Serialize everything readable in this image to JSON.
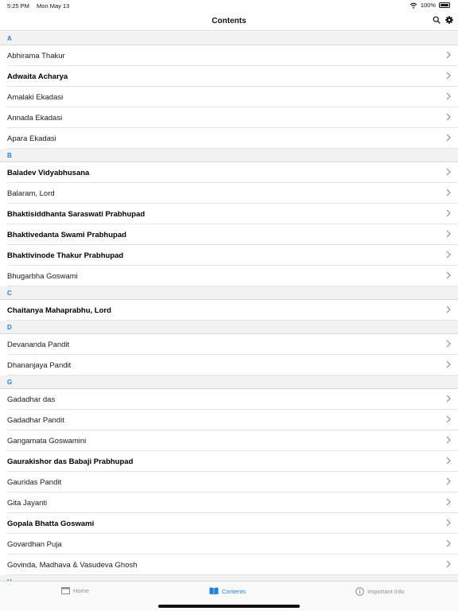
{
  "status_bar": {
    "time": "5:25 PM",
    "date": "Mon May 13",
    "battery": "100%"
  },
  "nav": {
    "title": "Contents",
    "actions": [
      "search-icon",
      "gear-icon"
    ]
  },
  "sections": [
    {
      "letter": "A",
      "items": [
        {
          "label": "Abhirama Thakur",
          "bold": false
        },
        {
          "label": "Adwaita Acharya",
          "bold": true
        },
        {
          "label": "Amalaki Ekadasi",
          "bold": false
        },
        {
          "label": "Annada Ekadasi",
          "bold": false
        },
        {
          "label": "Apara Ekadasi",
          "bold": false
        }
      ]
    },
    {
      "letter": "B",
      "items": [
        {
          "label": "Baladev Vidyabhusana",
          "bold": true
        },
        {
          "label": "Balaram, Lord",
          "bold": false
        },
        {
          "label": "Bhaktisiddhanta Saraswati Prabhupad",
          "bold": true
        },
        {
          "label": "Bhaktivedanta Swami Prabhupad",
          "bold": true
        },
        {
          "label": "Bhaktivinode Thakur Prabhupad",
          "bold": true
        },
        {
          "label": "Bhugarbha Goswami",
          "bold": false
        }
      ]
    },
    {
      "letter": "C",
      "items": [
        {
          "label": "Chaitanya Mahaprabhu, Lord",
          "bold": true
        }
      ]
    },
    {
      "letter": "D",
      "items": [
        {
          "label": "Devananda Pandit",
          "bold": false
        },
        {
          "label": "Dhananjaya Pandit",
          "bold": false
        }
      ]
    },
    {
      "letter": "G",
      "items": [
        {
          "label": "Gadadhar das",
          "bold": false
        },
        {
          "label": "Gadadhar Pandit",
          "bold": false
        },
        {
          "label": "Gangamata Goswamini",
          "bold": false
        },
        {
          "label": "Gaurakishor das Babaji Prabhupad",
          "bold": true
        },
        {
          "label": "Gauridas Pandit",
          "bold": false
        },
        {
          "label": "Gita Jayanti",
          "bold": false
        },
        {
          "label": "Gopala Bhatta Goswami",
          "bold": true
        },
        {
          "label": "Govardhan Puja",
          "bold": false
        },
        {
          "label": "Govinda, Madhava & Vasudeva Ghosh",
          "bold": false
        }
      ]
    },
    {
      "letter": "H",
      "items": []
    }
  ],
  "tabs": [
    {
      "label": "Home",
      "icon": "home-icon",
      "active": false
    },
    {
      "label": "Contents",
      "icon": "book-icon",
      "active": true
    },
    {
      "label": "Important Info",
      "icon": "info-icon",
      "active": false
    }
  ],
  "colors": {
    "accent": "#1e7fd6",
    "section_bg": "#f2f2f2",
    "inactive": "#8c8c8c"
  }
}
